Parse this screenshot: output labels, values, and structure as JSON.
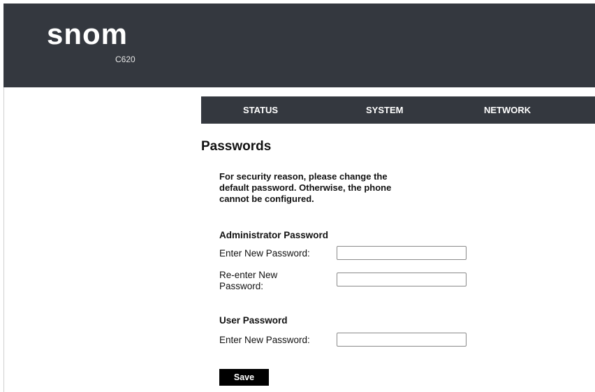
{
  "header": {
    "logo": "snom",
    "model": "C620"
  },
  "nav": {
    "items": [
      {
        "label": "STATUS"
      },
      {
        "label": "SYSTEM"
      },
      {
        "label": "NETWORK"
      }
    ]
  },
  "page": {
    "title": "Passwords",
    "notice": "For security reason, please change the default password. Otherwise, the phone cannot be configured."
  },
  "admin": {
    "title": "Administrator Password",
    "new_label": "Enter New Password:",
    "new_value": "",
    "reenter_label": "Re-enter New Password:",
    "reenter_value": ""
  },
  "user": {
    "title": "User Password",
    "new_label": "Enter New Password:",
    "new_value": ""
  },
  "actions": {
    "save_label": "Save"
  },
  "colors": {
    "header_bg": "#34383f",
    "button_bg": "#000000",
    "text": "#111111"
  }
}
